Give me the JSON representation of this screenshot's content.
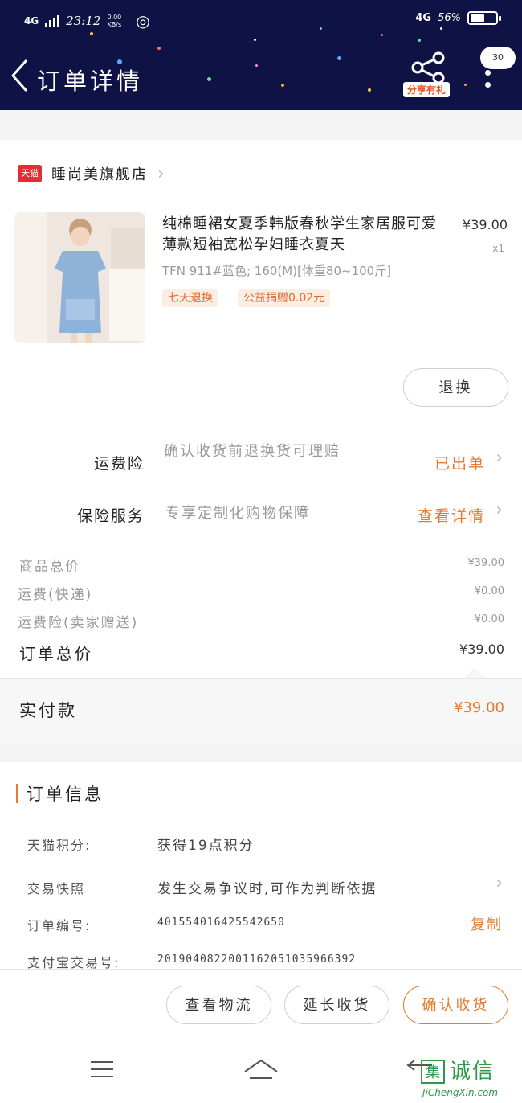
{
  "status_bar": {
    "network": "4G",
    "time": "23:12",
    "speed_value": "0.00",
    "speed_unit": "KB/s",
    "right_network": "4G",
    "battery": "56%",
    "battery_level": 0.56
  },
  "header": {
    "title": "订单详情",
    "share_label": "分享有礼",
    "message_count": "30",
    "icons": [
      "back-icon",
      "share-icon",
      "more-icon"
    ]
  },
  "shop": {
    "badge": "天猫",
    "name": "睡尚美旗舰店"
  },
  "product": {
    "title": "纯棉睡裙女夏季韩版春秋学生家居服可爱薄款短袖宽松孕妇睡衣夏天",
    "sku": "TFN 911#蓝色; 160(M)[体重80~100斤]",
    "tags": [
      "七天退换",
      "公益捐赠0.02元"
    ],
    "price": "¥39.00",
    "quantity": "x1",
    "return_button": "退换"
  },
  "insurance": [
    {
      "label": "运费险",
      "desc": "确认收货前退换货可理赔",
      "status": "已出单"
    },
    {
      "label": "保险服务",
      "desc": "专享定制化购物保障",
      "status": "查看详情"
    }
  ],
  "fees": [
    {
      "label": "商品总价",
      "value": "¥39.00"
    },
    {
      "label": "运费(快递)",
      "value": "¥0.00"
    },
    {
      "label": "运费险(卖家赠送)",
      "value": "¥0.00"
    }
  ],
  "total": {
    "label": "订单总价",
    "value": "¥39.00"
  },
  "paid": {
    "label": "实付款",
    "value": "¥39.00"
  },
  "order_info": {
    "title": "订单信息",
    "rows": [
      {
        "label": "天猫积分:",
        "value": "获得19点积分"
      },
      {
        "label": "交易快照",
        "value": "发生交易争议时,可作为判断依据"
      },
      {
        "label": "订单编号:",
        "value": "401554016425542650"
      },
      {
        "label": "支付宝交易号:",
        "value": "2019040822001162051035966392"
      }
    ],
    "copy_label": "复制"
  },
  "actions": {
    "logistics": "查看物流",
    "extend": "延长收货",
    "confirm": "确认收货"
  },
  "watermark": {
    "mark": "集",
    "text": "诚信",
    "url": "JiChengXin.com"
  },
  "colors": {
    "header_bg": "#0f1245",
    "accent": "#e8792e",
    "tmall_red": "#e72b33"
  }
}
